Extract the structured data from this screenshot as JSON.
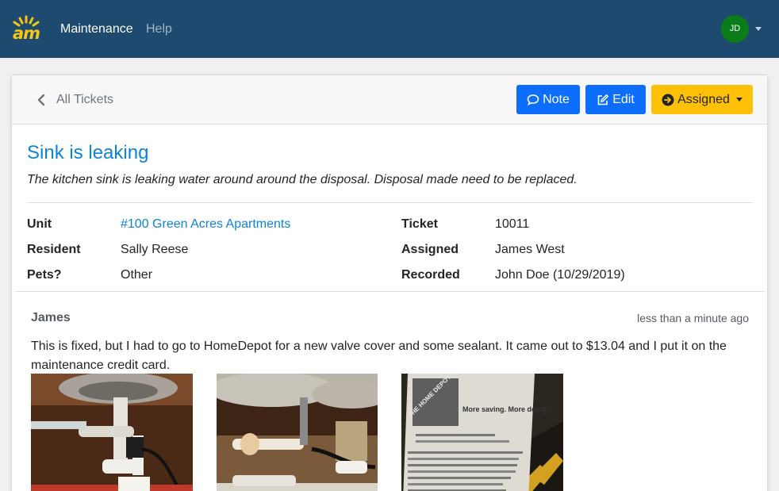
{
  "app": {
    "logo_text": "am",
    "nav": {
      "maintenance": "Maintenance",
      "help": "Help"
    },
    "user_initials": "JD"
  },
  "header": {
    "back_label": "All Tickets",
    "note_button": "Note",
    "edit_button": "Edit",
    "status_button": "Assigned"
  },
  "ticket": {
    "title": "Sink is leaking",
    "description": "The kitchen sink is leaking water around around the disposal. Disposal made need to be replaced.",
    "fields": {
      "unit_label": "Unit",
      "unit_value": "#100 Green Acres Apartments",
      "resident_label": "Resident",
      "resident_value": "Sally Reese",
      "pets_label": "Pets?",
      "pets_value": "Other",
      "ticket_label": "Ticket",
      "ticket_value": "10011",
      "assigned_label": "Assigned",
      "assigned_value": "James West",
      "recorded_label": "Recorded",
      "recorded_value": "John Doe (10/29/2019)"
    }
  },
  "note": {
    "author": "James",
    "time": "less than a minute ago",
    "text": "This is fixed, but I had to go to HomeDepot for a new valve cover and some sealant. It came out to $13.04 and I put it on the maintenance credit card.",
    "receipt": {
      "brand": "THE HOME DEPOT",
      "tagline": "More saving. More doing."
    }
  },
  "colors": {
    "navbar": "#1d4a6e",
    "primary": "#0d6efd",
    "warning": "#ffc107",
    "link": "#0d84d8",
    "avatar": "#0b7d18",
    "logo": "#f5c518"
  },
  "icons": {
    "back": "chevron-left-icon",
    "note": "comment-icon",
    "edit": "edit-icon",
    "status": "arrow-circle-right-icon",
    "dropdown": "caret-down-icon"
  }
}
